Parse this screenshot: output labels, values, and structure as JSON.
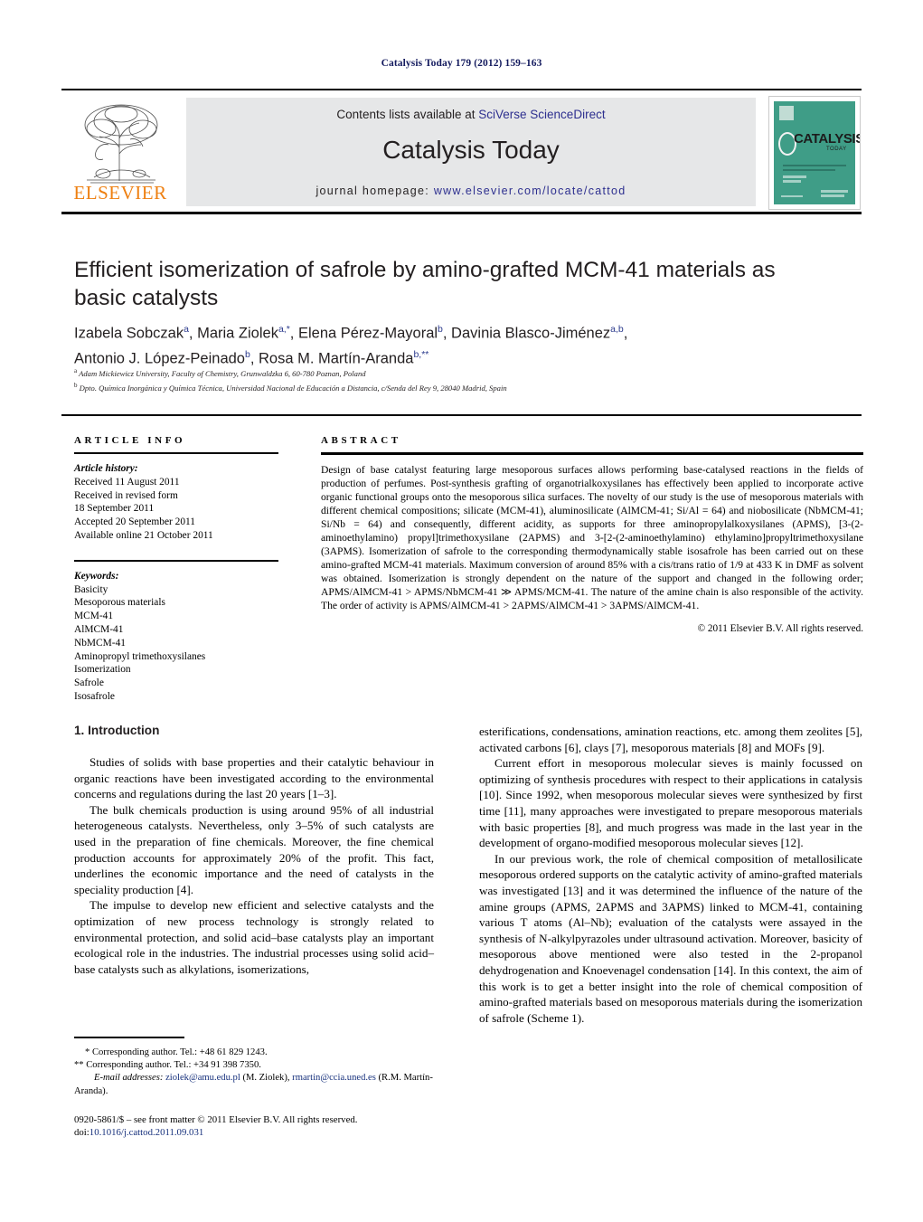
{
  "running_head": "Catalysis Today 179 (2012) 159–163",
  "masthead": {
    "publisher_name": "ELSEVIER",
    "contents_prefix": "Contents lists available at ",
    "contents_link": "SciVerse ScienceDirect",
    "journal_title": "Catalysis Today",
    "homepage_prefix": "journal homepage: ",
    "homepage_url": "www.elsevier.com/locate/cattod",
    "cover_title": "CATALYSIS",
    "cover_subtitle": "TODAY",
    "cover_color": "#3f9d87",
    "link_color": "#2d2f8f",
    "brand_color": "#ee8012"
  },
  "article": {
    "title": "Efficient isomerization of safrole by amino-grafted MCM-41 materials as basic catalysts",
    "authors_line1": "Izabela Sobczak a , Maria Ziolek a,* , Elena Pérez-Mayoral b , Davinia Blasco-Jiménez a,b ,",
    "authors_line2": "Antonio J. López-Peinado b , Rosa M. Martín-Aranda b,**",
    "affiliation_a": "Adam Mickiewicz University, Faculty of Chemistry, Grunwaldzka 6, 60-780 Poznan, Poland",
    "affiliation_b": "Dpto. Química Inorgánica y Química Técnica, Universidad Nacional de Educación a Distancia, c/Senda del Rey 9, 28040 Madrid, Spain"
  },
  "info": {
    "heading": "ARTICLE INFO",
    "history_label": "Article history:",
    "history": [
      "Received 11 August 2011",
      "Received in revised form",
      "18 September 2011",
      "Accepted 20 September 2011",
      "Available online 21 October 2011"
    ],
    "keywords_label": "Keywords:",
    "keywords": [
      "Basicity",
      "Mesoporous materials",
      "MCM-41",
      "AlMCM-41",
      "NbMCM-41",
      "Aminopropyl trimethoxysilanes",
      "Isomerization",
      "Safrole",
      "Isosafrole"
    ]
  },
  "abstract": {
    "heading": "ABSTRACT",
    "text": "Design of base catalyst featuring large mesoporous surfaces allows performing base-catalysed reactions in the fields of production of perfumes. Post-synthesis grafting of organotrialkoxysilanes has effectively been applied to incorporate active organic functional groups onto the mesoporous silica surfaces. The novelty of our study is the use of mesoporous materials with different chemical compositions; silicate (MCM-41), aluminosilicate (AlMCM-41; Si/Al = 64) and niobosilicate (NbMCM-41; Si/Nb = 64) and consequently, different acidity, as supports for three aminopropylalkoxysilanes (APMS), [3-(2-aminoethylamino) propyl]trimethoxysilane (2APMS) and 3-[2-(2-aminoethylamino) ethylamino]propyltrimethoxysilane (3APMS). Isomerization of safrole to the corresponding thermodynamically stable isosafrole has been carried out on these amino-grafted MCM-41 materials. Maximum conversion of around 85% with a cis/trans ratio of 1/9 at 433 K in DMF as solvent was obtained. Isomerization is strongly dependent on the nature of the support and changed in the following order; APMS/AlMCM-41 > APMS/NbMCM-41 ≫ APMS/MCM-41. The nature of the amine chain is also responsible of the activity. The order of activity is APMS/AlMCM-41 > 2APMS/AlMCM-41 > 3APMS/AlMCM-41.",
    "copyright": "© 2011 Elsevier B.V. All rights reserved."
  },
  "body": {
    "section_heading": "1. Introduction",
    "left_paragraphs": [
      "Studies of solids with base properties and their catalytic behaviour in organic reactions have been investigated according to the environmental concerns and regulations during the last 20 years [1–3].",
      "The bulk chemicals production is using around 95% of all industrial heterogeneous catalysts. Nevertheless, only 3–5% of such catalysts are used in the preparation of fine chemicals. Moreover, the fine chemical production accounts for approximately 20% of the profit. This fact, underlines the economic importance and the need of catalysts in the speciality production [4].",
      "The impulse to develop new efficient and selective catalysts and the optimization of new process technology is strongly related to environmental protection, and solid acid–base catalysts play an important ecological role in the industries. The industrial processes using solid acid–base catalysts such as alkylations, isomerizations,"
    ],
    "right_paragraphs": [
      "esterifications, condensations, amination reactions, etc. among them zeolites [5], activated carbons [6], clays [7], mesoporous materials [8] and MOFs [9].",
      "Current effort in mesoporous molecular sieves is mainly focussed on optimizing of synthesis procedures with respect to their applications in catalysis [10]. Since 1992, when mesoporous molecular sieves were synthesized by first time [11], many approaches were investigated to prepare mesoporous materials with basic properties [8], and much progress was made in the last year in the development of organo-modified mesoporous molecular sieves [12].",
      "In our previous work, the role of chemical composition of metallosilicate mesoporous ordered supports on the catalytic activity of amino-grafted materials was investigated [13] and it was determined the influence of the nature of the amine groups (APMS, 2APMS and 3APMS) linked to MCM-41, containing various T atoms (Al–Nb); evaluation of the catalysts were assayed in the synthesis of N-alkylpyrazoles under ultrasound activation. Moreover, basicity of mesoporous above mentioned were also tested in the 2-propanol dehydrogenation and Knoevenagel condensation [14]. In this context, the aim of this work is to get a better insight into the role of chemical composition of amino-grafted materials based on mesoporous materials during the isomerization of safrole (Scheme 1)."
    ]
  },
  "footnotes": {
    "corresponding1": "* Corresponding author. Tel.: +48 61 829 1243.",
    "corresponding2": "** Corresponding author. Tel.: +34 91 398 7350.",
    "email_label": "E-mail addresses:",
    "email1": "ziolek@amu.edu.pl",
    "email1_owner": "(M. Ziolek),",
    "email2": "rmartin@ccia.uned.es",
    "email2_owner": "(R.M. Martín-Aranda)."
  },
  "imprint": {
    "line1": "0920-5861/$ – see front matter © 2011 Elsevier B.V. All rights reserved.",
    "doi_label": "doi:",
    "doi_value": "10.1016/j.cattod.2011.09.031"
  }
}
